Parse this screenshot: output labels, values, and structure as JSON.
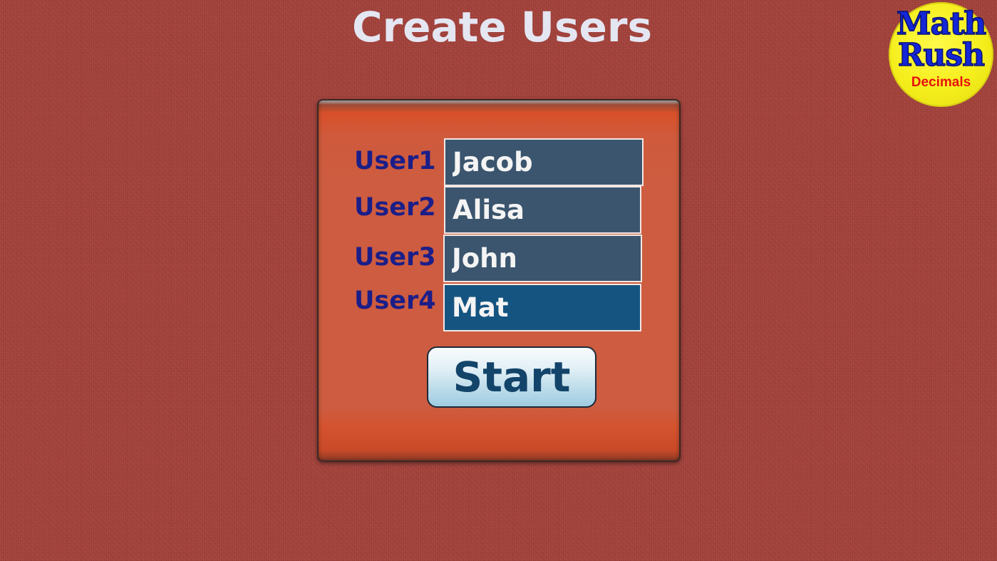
{
  "header": {
    "title": "Create Users"
  },
  "logo": {
    "line1": "Math",
    "line2": "Rush",
    "subtitle": "Decimals"
  },
  "form": {
    "users": [
      {
        "label": "User1",
        "value": "Jacob"
      },
      {
        "label": "User2",
        "value": "Alisa"
      },
      {
        "label": "User3",
        "value": "John"
      },
      {
        "label": "User4",
        "value": "Mat"
      }
    ],
    "start_label": "Start"
  },
  "colors": {
    "background": "#a6433c",
    "panel": "#cd5c40",
    "label_text": "#1b1e88",
    "input_bg": "#3b556e",
    "input_bg_active": "#155480",
    "title_text": "#e4e6f2",
    "logo_yellow": "#f5ee1c",
    "logo_blue": "#1426d8",
    "logo_red": "#e8120f"
  }
}
